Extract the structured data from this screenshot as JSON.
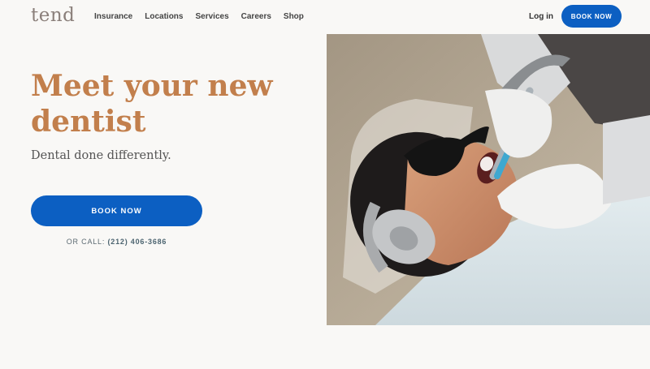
{
  "header": {
    "logo": "tend",
    "nav": [
      "Insurance",
      "Locations",
      "Services",
      "Careers",
      "Shop"
    ],
    "login": "Log in",
    "book_button": "BOOK NOW"
  },
  "hero": {
    "headline": "Meet your new dentist",
    "subhead": "Dental done differently.",
    "book_button": "BOOK NOW",
    "call_prefix": "OR CALL:",
    "phone": "(212) 406-3686"
  },
  "colors": {
    "background": "#f9f8f6",
    "accent_copper": "#c27f4c",
    "button_blue": "#0c5fc2"
  }
}
